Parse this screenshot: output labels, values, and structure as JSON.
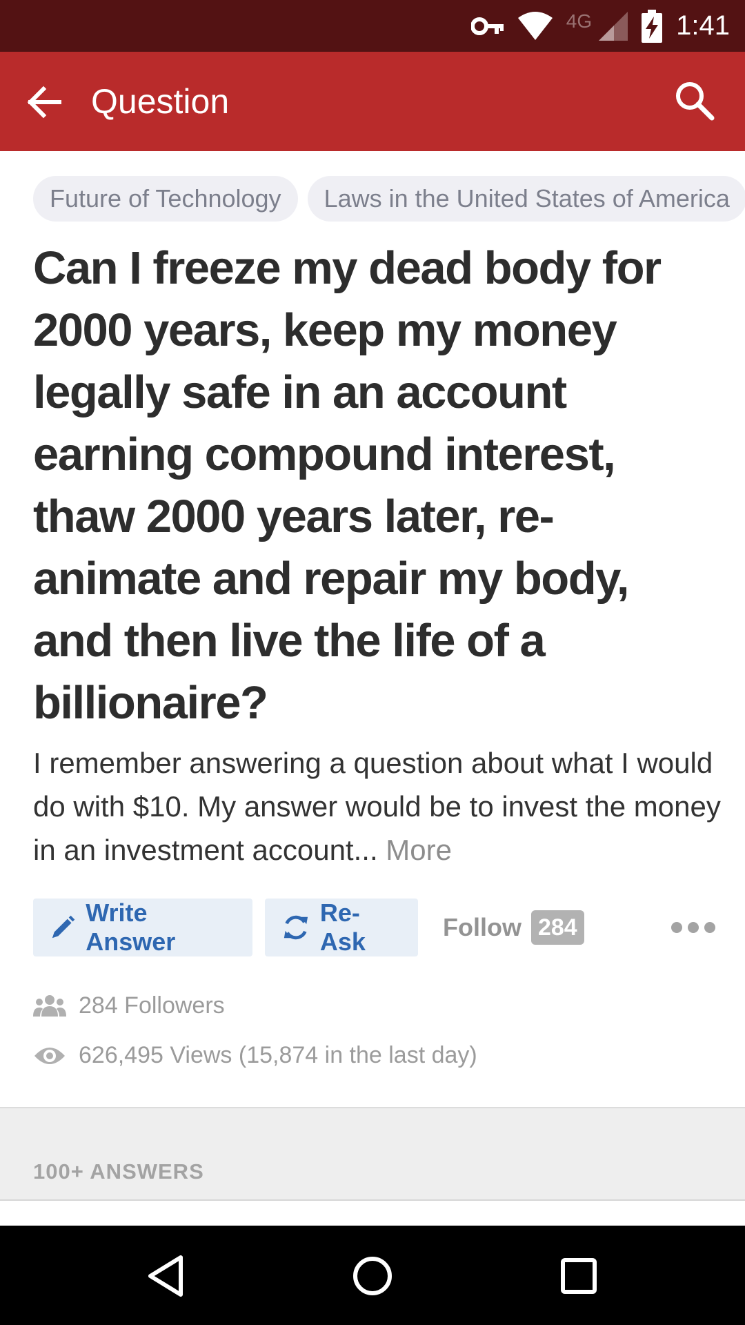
{
  "status_bar": {
    "network_type": "4G",
    "time": "1:41",
    "icons": [
      "vpn-key-icon",
      "wifi-icon",
      "cell-signal-icon",
      "battery-charging-icon"
    ],
    "background": "#531213"
  },
  "app_bar": {
    "title": "Question",
    "back_icon": "arrow-back-icon",
    "search_icon": "search-icon",
    "background": "#b92b2b"
  },
  "topics": [
    "Future of Technology",
    "Laws in the United States of America"
  ],
  "question": {
    "title": "Can I freeze my dead body for 2000 years, keep my money legally safe in an account earning compound interest, thaw 2000 years later, re-animate and repair my body, and then live the life of a billionaire?",
    "body": "I remember answering a question about what I would do with $10. My answer would be to invest the money in an investment account...",
    "more_label": "More"
  },
  "actions": {
    "write_answer": "Write Answer",
    "re_ask": "Re-Ask",
    "follow": "Follow",
    "follow_count": "284",
    "accent": "#2e67b1"
  },
  "stats": {
    "followers": "284 Followers",
    "views": "626,495 Views (15,874 in the last day)"
  },
  "answers": {
    "label": "100+ ANSWERS"
  },
  "nav_bar": {
    "icons": [
      "back-triangle-icon",
      "home-circle-icon",
      "recents-square-icon"
    ]
  }
}
